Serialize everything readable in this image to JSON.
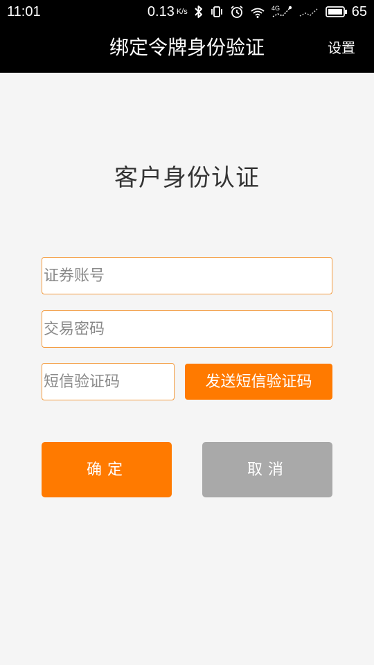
{
  "status_bar": {
    "time": "11:01",
    "net_speed": "0.13",
    "net_speed_unit": "K/s",
    "signal_type": "4G",
    "battery": "65",
    "icons": [
      "bluetooth-icon",
      "vibrate-icon",
      "alarm-icon",
      "wifi-icon",
      "mobile-signal-icon",
      "no-signal-icon",
      "battery-icon"
    ]
  },
  "app_bar": {
    "title": "绑定令牌身份验证",
    "settings_label": "设置"
  },
  "form": {
    "heading": "客户身份认证",
    "account_placeholder": "证券账号",
    "password_placeholder": "交易密码",
    "sms_code_placeholder": "短信验证码",
    "send_sms_label": "发送短信验证码",
    "confirm_label": "确定",
    "cancel_label": "取消"
  },
  "colors": {
    "accent": "#ff7a00",
    "input_border": "#f39a3c",
    "cancel": "#a9a9a9",
    "background": "#f5f5f5",
    "bar": "#000000"
  }
}
